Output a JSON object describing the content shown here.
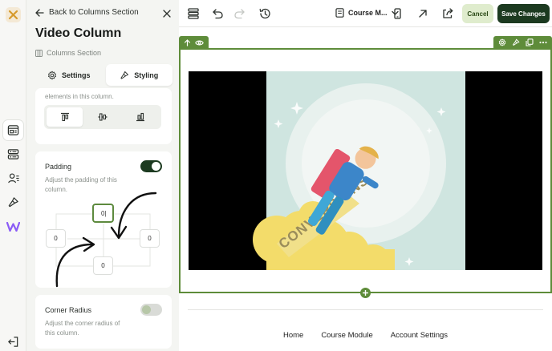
{
  "panel": {
    "back_label": "Back to Columns Section",
    "title": "Video Column",
    "subtitle": "Columns Section",
    "tabs": [
      {
        "label": "Settings",
        "active": false
      },
      {
        "label": "Styling",
        "active": true
      }
    ],
    "alignment": {
      "description_tail": "elements in this column.",
      "options": [
        "align-top",
        "align-center",
        "align-bottom"
      ],
      "selected": "align-top"
    },
    "padding": {
      "label": "Padding",
      "description": "Adjust the padding of this column.",
      "enabled": true,
      "top": "0|",
      "left": "0",
      "right": "0",
      "bottom": "0"
    },
    "corner_radius": {
      "label": "Corner Radius",
      "description": "Adjust the corner radius of this column.",
      "enabled": false
    }
  },
  "topbar": {
    "course_label": "Course M...",
    "cancel_label": "Cancel",
    "save_label": "Save Changes"
  },
  "canvas": {
    "video_text": "CONVERSIONS"
  },
  "footer": {
    "nav": [
      "Home",
      "Course Module",
      "Account Settings"
    ]
  },
  "colors": {
    "accent": "#5e8c3a",
    "save_bg": "#1c3a20",
    "cancel_bg": "#dfeccd",
    "toggle_on": "#1c3a20",
    "toggle_off": "#d9dbd7"
  }
}
